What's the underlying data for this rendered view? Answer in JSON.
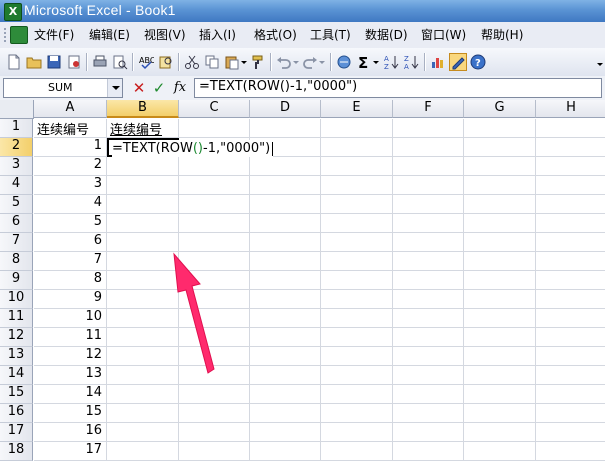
{
  "window": {
    "title": "Microsoft Excel - Book1"
  },
  "menu": [
    "文件(F)",
    "编辑(E)",
    "视图(V)",
    "插入(I)",
    "格式(O)",
    "工具(T)",
    "数据(D)",
    "窗口(W)",
    "帮助(H)"
  ],
  "formula_bar": {
    "name_box": "SUM",
    "cancel_symbol": "✕",
    "enter_symbol": "✓",
    "fx_symbol": "fx",
    "formula": "=TEXT(ROW()-1,\"0000\")"
  },
  "columns": [
    "A",
    "B",
    "C",
    "D",
    "E",
    "F",
    "G",
    "H"
  ],
  "rows": [
    "1",
    "2",
    "3",
    "4",
    "5",
    "6",
    "7",
    "8",
    "9",
    "10",
    "11",
    "12",
    "13",
    "14",
    "15",
    "16",
    "17",
    "18"
  ],
  "selected": {
    "column": "B",
    "row": "2"
  },
  "cells": {
    "A1": "连续编号",
    "B1": "连续编号",
    "A_values": [
      "1",
      "2",
      "3",
      "4",
      "5",
      "6",
      "7",
      "8",
      "9",
      "10",
      "11",
      "12",
      "13",
      "14",
      "15",
      "16",
      "17"
    ]
  },
  "editing": {
    "part1": "=TEXT(ROW",
    "paren": "()",
    "part2": "-1,\"0000\")"
  },
  "colors": {
    "title_bar": "#5a93d4",
    "selection_header": "#f3cf6a",
    "annotation_arrow": "#ff2a6d",
    "formula_paren": "#1d8a32"
  }
}
